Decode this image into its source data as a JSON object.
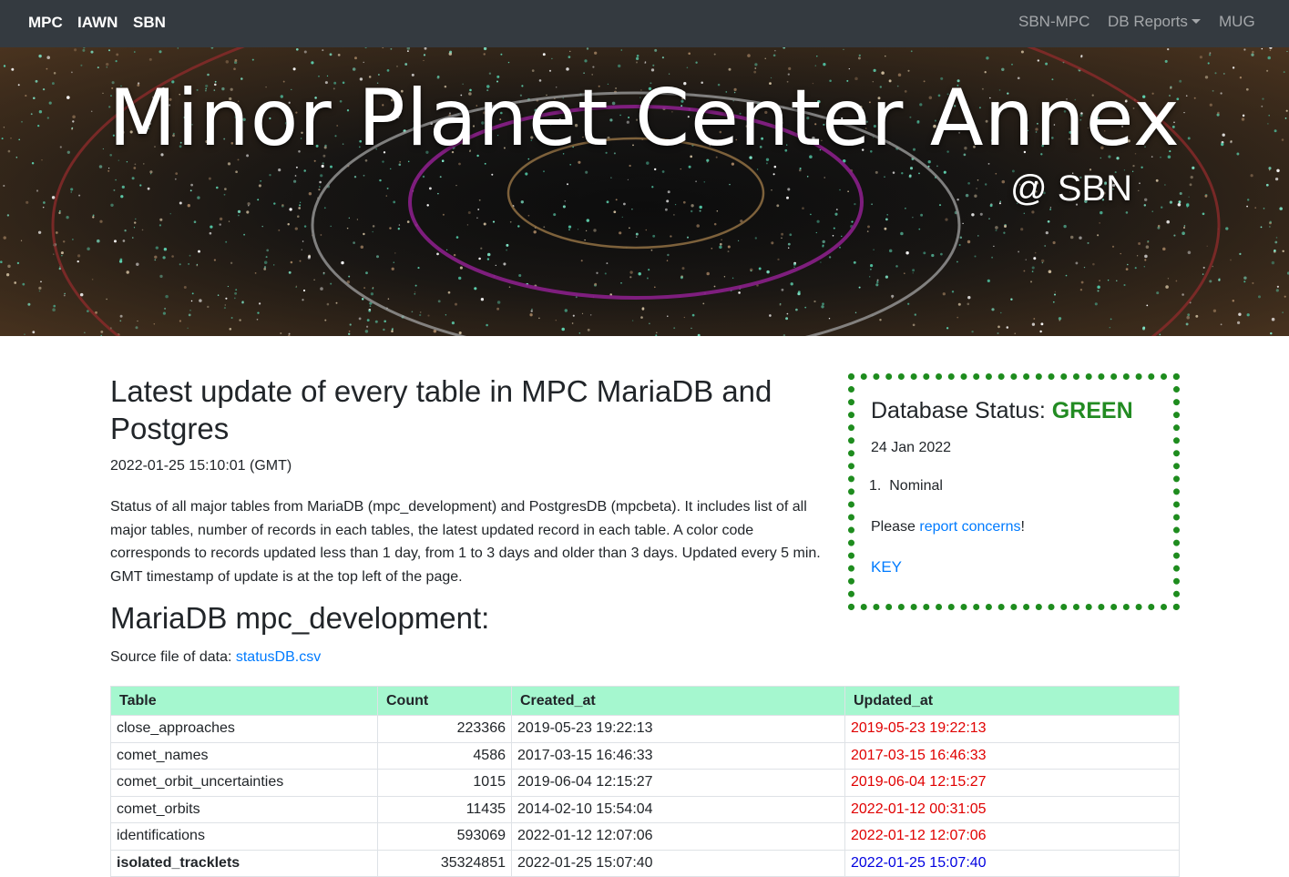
{
  "nav": {
    "left": [
      "MPC",
      "IAWN",
      "SBN"
    ],
    "right": {
      "sbn_mpc": "SBN-MPC",
      "db_reports": "DB Reports",
      "mug": "MUG"
    }
  },
  "banner": {
    "title": "Minor Planet Center Annex",
    "subtitle": "@ SBN"
  },
  "main": {
    "title": "Latest update of every table in MPC MariaDB and Postgres",
    "timestamp": "2022-01-25 15:10:01 (GMT)",
    "description": "Status of all major tables from MariaDB (mpc_development) and PostgresDB (mpcbeta). It includes list of all major tables, number of records in each tables, the latest updated record in each table. A color code corresponds to records updated less than 1 day, from 1 to 3 days and older than 3 days. Updated every 5 min. GMT timestamp of update is at the top left of the page.",
    "section_title": "MariaDB mpc_development:",
    "source_prefix": "Source file of data: ",
    "source_link": "statusDB.csv"
  },
  "status": {
    "heading_prefix": "Database Status: ",
    "heading_status": "GREEN",
    "date": "24 Jan 2022",
    "item_number": "1.",
    "item_text": "Nominal",
    "please_prefix": "Please ",
    "please_link": "report concerns",
    "please_suffix": "!",
    "key": "KEY"
  },
  "table": {
    "headers": [
      "Table",
      "Count",
      "Created_at",
      "Updated_at"
    ],
    "rows": [
      {
        "table": "close_approaches",
        "count": "223366",
        "created": "2019-05-23 19:22:13",
        "updated": "2019-05-23 19:22:13",
        "status": "red"
      },
      {
        "table": "comet_names",
        "count": "4586",
        "created": "2017-03-15 16:46:33",
        "updated": "2017-03-15 16:46:33",
        "status": "red"
      },
      {
        "table": "comet_orbit_uncertainties",
        "count": "1015",
        "created": "2019-06-04 12:15:27",
        "updated": "2019-06-04 12:15:27",
        "status": "red"
      },
      {
        "table": "comet_orbits",
        "count": "11435",
        "created": "2014-02-10 15:54:04",
        "updated": "2022-01-12 00:31:05",
        "status": "red"
      },
      {
        "table": "identifications",
        "count": "593069",
        "created": "2022-01-12 12:07:06",
        "updated": "2022-01-12 12:07:06",
        "status": "red"
      },
      {
        "table": "isolated_tracklets",
        "count": "35324851",
        "created": "2022-01-25 15:07:40",
        "updated": "2022-01-25 15:07:40",
        "status": "blue"
      }
    ]
  },
  "colors": {
    "navbar": "#343a40",
    "table_header": "#a5f7cf",
    "status_border": "#1e8c1e",
    "status_green": "#228b22",
    "link": "#007bff",
    "old": "#e00000",
    "fresh": "#0000e0"
  }
}
